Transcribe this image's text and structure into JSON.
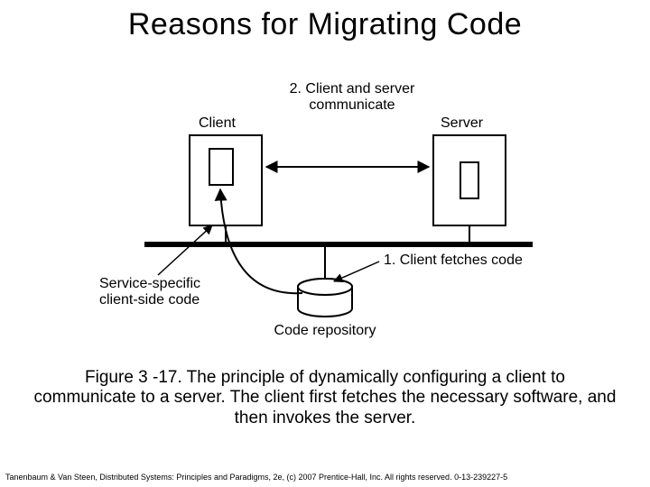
{
  "title": "Reasons for Migrating Code",
  "diagram": {
    "client_label": "Client",
    "server_label": "Server",
    "step2": "2. Client and server\ncommunicate",
    "step1": "1. Client fetches code",
    "service_specific": "Service-specific\nclient-side code",
    "code_repo": "Code repository"
  },
  "caption": "Figure 3 -17. The principle of dynamically configuring a client to communicate to a server. The client first fetches the necessary software, and then invokes the server.",
  "credit": "Tanenbaum & Van Steen, Distributed Systems: Principles and Paradigms, 2e, (c) 2007 Prentice-Hall, Inc. All rights reserved. 0-13-239227-5"
}
